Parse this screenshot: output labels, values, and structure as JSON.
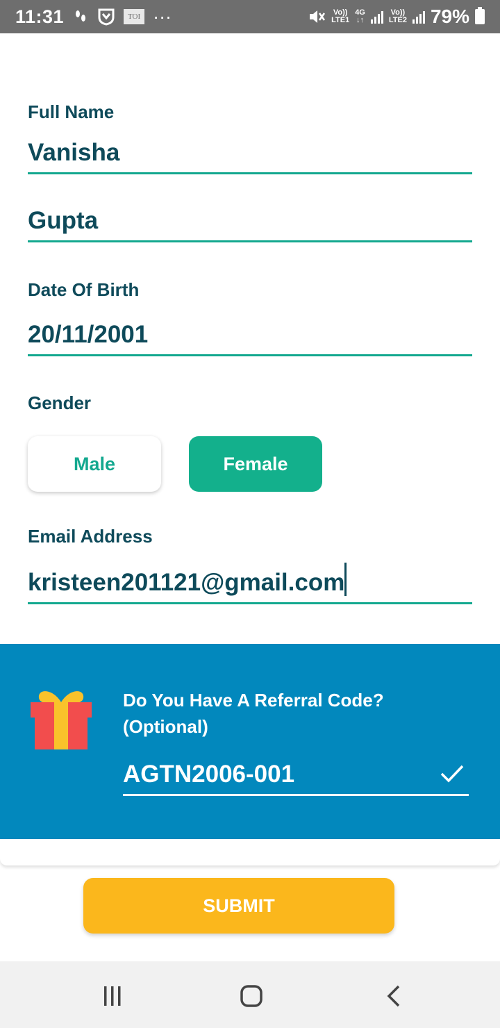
{
  "status_bar": {
    "time": "11:31",
    "notif_icons": [
      "footsteps-icon",
      "shield-m-icon",
      "toi-app-icon",
      "more-dots-icon"
    ],
    "toi_label": "TOI",
    "dots": "···",
    "sim1_label_top": "Vo))",
    "sim1_label_bottom": "LTE1",
    "net_label_top": "4G",
    "net_label_bottom": "↓↑",
    "sim2_label_top": "Vo))",
    "sim2_label_bottom": "LTE2",
    "battery": "79%"
  },
  "form": {
    "full_name_label": "Full Name",
    "first_name": "Vanisha",
    "last_name": "Gupta",
    "dob_label": "Date Of Birth",
    "dob": "20/11/2001",
    "gender_label": "Gender",
    "gender_male": "Male",
    "gender_female": "Female",
    "gender_selected": "Female",
    "email_label": "Email Address",
    "email": "kristeen201121@gmail.com"
  },
  "referral": {
    "title_line1": "Do You Have A Referral Code?",
    "title_line2": "(Optional)",
    "code": "AGTN2006-001",
    "background_color": "#0288bd"
  },
  "actions": {
    "submit_label": "SUBMIT",
    "submit_color": "#fbb71c"
  },
  "colors": {
    "accent": "#13a88f",
    "text_primary": "#0e4a5a"
  }
}
